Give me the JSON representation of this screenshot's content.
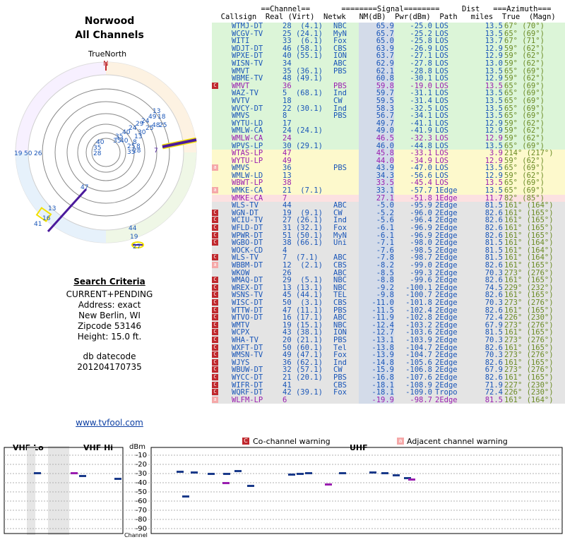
{
  "title_line1": "Norwood",
  "title_line2": "All Channels",
  "compass_label": "TrueNorth",
  "compass_n": "N",
  "criteria": {
    "heading": "Search Criteria",
    "lines": [
      "CURRENT+PENDING",
      "Address: exact",
      "New Berlin, WI",
      "Zipcode 53146",
      "Height: 15.0 ft."
    ],
    "db_label": "db datecode",
    "db_value": "201204170735"
  },
  "link": "www.tvfool.com",
  "headers": {
    "line1": "           ==Channel==       ========Signal========     Dist   ===Azimuth===",
    "line2": "  Callsign  Real (Virt)  Netwk   NM(dB)  Pwr(dBm)  Path   miles  True  (Magn)"
  },
  "rows": [
    {
      "cs": "WTMJ-DT",
      "real": "28  (4.1)",
      "net": "NBC",
      "nm": "65.9",
      "pwr": "-25.0",
      "path": "LOS",
      "dist": "13.5",
      "az": "67° (70°)",
      "bg": "green",
      "color": "#1a56b8",
      "b": ""
    },
    {
      "cs": "WCGV-TV",
      "real": "25 (24.1)",
      "net": "MyN",
      "nm": "65.7",
      "pwr": "-25.2",
      "path": "LOS",
      "dist": "13.5",
      "az": "65° (69°)",
      "bg": "green",
      "color": "#1a56b8",
      "b": ""
    },
    {
      "cs": "WITI",
      "real": "33  (6.1)",
      "net": "Fox",
      "nm": "65.0",
      "pwr": "-25.8",
      "path": "LOS",
      "dist": "13.7",
      "az": "67° (71°)",
      "bg": "green",
      "color": "#1a56b8",
      "b": ""
    },
    {
      "cs": "WDJT-DT",
      "real": "46 (58.1)",
      "net": "CBS",
      "nm": "63.9",
      "pwr": "-26.9",
      "path": "LOS",
      "dist": "12.9",
      "az": "59° (62°)",
      "bg": "green",
      "color": "#1a56b8",
      "b": ""
    },
    {
      "cs": "WPXE-DT",
      "real": "40 (55.1)",
      "net": "ION",
      "nm": "63.7",
      "pwr": "-27.1",
      "path": "LOS",
      "dist": "12.9",
      "az": "59° (62°)",
      "bg": "green",
      "color": "#1a56b8",
      "b": ""
    },
    {
      "cs": "WISN-TV",
      "real": "34",
      "net": "ABC",
      "nm": "62.9",
      "pwr": "-27.8",
      "path": "LOS",
      "dist": "13.0",
      "az": "59° (62°)",
      "bg": "green",
      "color": "#1a56b8",
      "b": ""
    },
    {
      "cs": "WMVT",
      "real": "35 (36.1)",
      "net": "PBS",
      "nm": "62.1",
      "pwr": "-28.8",
      "path": "LOS",
      "dist": "13.5",
      "az": "65° (69°)",
      "bg": "green",
      "color": "#1a56b8",
      "b": ""
    },
    {
      "cs": "WBME-TV",
      "real": "48 (49.1)",
      "net": "",
      "nm": "60.8",
      "pwr": "-30.1",
      "path": "LOS",
      "dist": "12.9",
      "az": "59° (62°)",
      "bg": "green",
      "color": "#1a56b8",
      "b": ""
    },
    {
      "cs": "WMVT",
      "real": "36",
      "net": "PBS",
      "nm": "59.8",
      "pwr": "-19.0",
      "path": "LOS",
      "dist": "13.5",
      "az": "65° (69°)",
      "bg": "green",
      "color": "#9a1eb0",
      "b": "C"
    },
    {
      "cs": "WAZ-TV",
      "real": "5  (68.1)",
      "net": "Ind",
      "nm": "59.7",
      "pwr": "-31.1",
      "path": "LOS",
      "dist": "13.5",
      "az": "65° (69°)",
      "bg": "green",
      "color": "#1a56b8",
      "b": ""
    },
    {
      "cs": "WVTV",
      "real": "18",
      "net": "CW",
      "nm": "59.5",
      "pwr": "-31.4",
      "path": "LOS",
      "dist": "13.5",
      "az": "65° (69°)",
      "bg": "green",
      "color": "#1a56b8",
      "b": ""
    },
    {
      "cs": "WVCY-DT",
      "real": "22 (30.1)",
      "net": "Ind",
      "nm": "58.3",
      "pwr": "-32.5",
      "path": "LOS",
      "dist": "13.5",
      "az": "65° (69°)",
      "bg": "green",
      "color": "#1a56b8",
      "b": ""
    },
    {
      "cs": "WMVS",
      "real": "8",
      "net": "PBS",
      "nm": "56.7",
      "pwr": "-34.1",
      "path": "LOS",
      "dist": "13.5",
      "az": "65° (69°)",
      "bg": "green",
      "color": "#1a56b8",
      "b": ""
    },
    {
      "cs": "WYTU-LD",
      "real": "17",
      "net": "",
      "nm": "49.7",
      "pwr": "-41.1",
      "path": "LOS",
      "dist": "12.9",
      "az": "59° (62°)",
      "bg": "green",
      "color": "#1a56b8",
      "b": ""
    },
    {
      "cs": "WMLW-CA",
      "real": "24 (24.1)",
      "net": "",
      "nm": "49.0",
      "pwr": "-41.9",
      "path": "LOS",
      "dist": "12.9",
      "az": "59° (62°)",
      "bg": "green",
      "color": "#1a56b8",
      "b": ""
    },
    {
      "cs": "WMLW-CA",
      "real": "24",
      "net": "",
      "nm": "46.5",
      "pwr": "-32.3",
      "path": "LOS",
      "dist": "12.9",
      "az": "59° (62°)",
      "bg": "green",
      "color": "#9a1eb0",
      "b": ""
    },
    {
      "cs": "WPVS-LP",
      "real": "30 (29.1)",
      "net": "",
      "nm": "46.0",
      "pwr": "-44.8",
      "path": "LOS",
      "dist": "13.5",
      "az": "65° (69°)",
      "bg": "green",
      "color": "#1a56b8",
      "b": ""
    },
    {
      "cs": "WTAS-LP",
      "real": "47",
      "net": "",
      "nm": "45.8",
      "pwr": "-33.1",
      "path": "LOS",
      "dist": "3.9",
      "az": "214° (217°)",
      "bg": "yellow",
      "color": "#9a1eb0",
      "b": ""
    },
    {
      "cs": "WYTU-LP",
      "real": "49",
      "net": "",
      "nm": "44.0",
      "pwr": "-34.9",
      "path": "LOS",
      "dist": "12.9",
      "az": "59° (62°)",
      "bg": "yellow",
      "color": "#9a1eb0",
      "b": ""
    },
    {
      "cs": "WMVS",
      "real": "36",
      "net": "PBS",
      "nm": "43.9",
      "pwr": "-47.0",
      "path": "LOS",
      "dist": "13.5",
      "az": "65° (69°)",
      "bg": "yellow",
      "color": "#1a56b8",
      "b": "a"
    },
    {
      "cs": "WMLW-LD",
      "real": "13",
      "net": "",
      "nm": "34.3",
      "pwr": "-56.6",
      "path": "LOS",
      "dist": "12.9",
      "az": "59° (62°)",
      "bg": "yellow",
      "color": "#1a56b8",
      "b": ""
    },
    {
      "cs": "WBWT-LP",
      "real": "38",
      "net": "",
      "nm": "33.5",
      "pwr": "-45.4",
      "path": "LOS",
      "dist": "13.5",
      "az": "65° (69°)",
      "bg": "yellow",
      "color": "#9a1eb0",
      "b": ""
    },
    {
      "cs": "WMKE-CA",
      "real": "21  (7.1)",
      "net": "",
      "nm": "33.1",
      "pwr": "-57.7",
      "path": "1Edge",
      "dist": "13.5",
      "az": "65° (69°)",
      "bg": "yellow",
      "color": "#1a56b8",
      "b": "a"
    },
    {
      "cs": "WMKE-CA",
      "real": "7",
      "net": "",
      "nm": "27.1",
      "pwr": "-51.8",
      "path": "1Edge",
      "dist": "11.7",
      "az": "82° (85°)",
      "bg": "pink",
      "color": "#9a1eb0",
      "b": ""
    },
    {
      "cs": "WLS-TV",
      "real": "44",
      "net": "ABC",
      "nm": "-5.0",
      "pwr": "-95.9",
      "path": "2Edge",
      "dist": "81.5",
      "az": "161° (164°)",
      "bg": "gray",
      "color": "#1a56b8",
      "b": ""
    },
    {
      "cs": "WGN-DT",
      "real": "19  (9.1)",
      "net": "CW",
      "nm": "-5.2",
      "pwr": "-96.0",
      "path": "2Edge",
      "dist": "82.6",
      "az": "161° (165°)",
      "bg": "gray",
      "color": "#1a56b8",
      "b": "C"
    },
    {
      "cs": "WCIU-TV",
      "real": "27 (26.1)",
      "net": "Ind",
      "nm": "-5.6",
      "pwr": "-96.4",
      "path": "2Edge",
      "dist": "82.6",
      "az": "161° (165°)",
      "bg": "gray",
      "color": "#1a56b8",
      "b": "C"
    },
    {
      "cs": "WFLD-DT",
      "real": "31 (32.1)",
      "net": "Fox",
      "nm": "-6.1",
      "pwr": "-96.9",
      "path": "2Edge",
      "dist": "82.6",
      "az": "161° (165°)",
      "bg": "gray",
      "color": "#1a56b8",
      "b": "C"
    },
    {
      "cs": "WPWR-DT",
      "real": "51 (50.1)",
      "net": "MyN",
      "nm": "-6.1",
      "pwr": "-96.9",
      "path": "2Edge",
      "dist": "82.6",
      "az": "161° (165°)",
      "bg": "gray",
      "color": "#1a56b8",
      "b": "C"
    },
    {
      "cs": "WGBO-DT",
      "real": "38 (66.1)",
      "net": "Uni",
      "nm": "-7.1",
      "pwr": "-98.0",
      "path": "2Edge",
      "dist": "81.5",
      "az": "161° (164°)",
      "bg": "gray",
      "color": "#1a56b8",
      "b": "C"
    },
    {
      "cs": "WOCK-CD",
      "real": "4",
      "net": "",
      "nm": "-7.6",
      "pwr": "-98.5",
      "path": "2Edge",
      "dist": "81.5",
      "az": "161° (164°)",
      "bg": "gray",
      "color": "#1a56b8",
      "b": ""
    },
    {
      "cs": "WLS-TV",
      "real": "7  (7.1)",
      "net": "ABC",
      "nm": "-7.8",
      "pwr": "-98.7",
      "path": "2Edge",
      "dist": "81.5",
      "az": "161° (164°)",
      "bg": "gray",
      "color": "#1a56b8",
      "b": "C"
    },
    {
      "cs": "WBBM-DT",
      "real": "12  (2.1)",
      "net": "CBS",
      "nm": "-8.2",
      "pwr": "-99.0",
      "path": "2Edge",
      "dist": "82.6",
      "az": "161° (165°)",
      "bg": "gray",
      "color": "#1a56b8",
      "b": "a"
    },
    {
      "cs": "WKOW",
      "real": "26",
      "net": "ABC",
      "nm": "-8.5",
      "pwr": "-99.3",
      "path": "2Edge",
      "dist": "70.3",
      "az": "273° (276°)",
      "bg": "gray",
      "color": "#1a56b8",
      "b": ""
    },
    {
      "cs": "WMAQ-DT",
      "real": "29  (5.1)",
      "net": "NBC",
      "nm": "-8.8",
      "pwr": "-99.6",
      "path": "2Edge",
      "dist": "82.6",
      "az": "161° (165°)",
      "bg": "gray",
      "color": "#1a56b8",
      "b": "C"
    },
    {
      "cs": "WREX-DT",
      "real": "13 (13.1)",
      "net": "NBC",
      "nm": "-9.2",
      "pwr": "-100.1",
      "path": "2Edge",
      "dist": "74.5",
      "az": "229° (232°)",
      "bg": "gray",
      "color": "#1a56b8",
      "b": "C"
    },
    {
      "cs": "WSNS-TV",
      "real": "45 (44.1)",
      "net": "TEL",
      "nm": "-9.8",
      "pwr": "-100.7",
      "path": "2Edge",
      "dist": "82.6",
      "az": "161° (165°)",
      "bg": "gray",
      "color": "#1a56b8",
      "b": "C"
    },
    {
      "cs": "WISC-DT",
      "real": "50  (3.1)",
      "net": "CBS",
      "nm": "-11.0",
      "pwr": "-101.8",
      "path": "2Edge",
      "dist": "70.3",
      "az": "273° (276°)",
      "bg": "gray",
      "color": "#1a56b8",
      "b": "C"
    },
    {
      "cs": "WTTW-DT",
      "real": "47 (11.1)",
      "net": "PBS",
      "nm": "-11.5",
      "pwr": "-102.4",
      "path": "2Edge",
      "dist": "82.6",
      "az": "161° (165°)",
      "bg": "gray",
      "color": "#1a56b8",
      "b": "C"
    },
    {
      "cs": "WTVO-DT",
      "real": "16 (17.1)",
      "net": "ABC",
      "nm": "-11.9",
      "pwr": "-102.8",
      "path": "2Edge",
      "dist": "72.4",
      "az": "226° (230°)",
      "bg": "gray",
      "color": "#1a56b8",
      "b": "C"
    },
    {
      "cs": "WMTV",
      "real": "19 (15.1)",
      "net": "NBC",
      "nm": "-12.4",
      "pwr": "-103.2",
      "path": "2Edge",
      "dist": "67.9",
      "az": "273° (276°)",
      "bg": "gray",
      "color": "#1a56b8",
      "b": "C"
    },
    {
      "cs": "WCPX",
      "real": "43 (38.1)",
      "net": "ION",
      "nm": "-12.7",
      "pwr": "-103.6",
      "path": "2Edge",
      "dist": "81.5",
      "az": "161° (165°)",
      "bg": "gray",
      "color": "#1a56b8",
      "b": "C"
    },
    {
      "cs": "WHA-TV",
      "real": "20 (21.1)",
      "net": "PBS",
      "nm": "-13.1",
      "pwr": "-103.9",
      "path": "2Edge",
      "dist": "70.3",
      "az": "273° (276°)",
      "bg": "gray",
      "color": "#1a56b8",
      "b": "C"
    },
    {
      "cs": "WXFT-DT",
      "real": "50 (60.1)",
      "net": "Tel",
      "nm": "-13.8",
      "pwr": "-104.7",
      "path": "2Edge",
      "dist": "82.6",
      "az": "161° (165°)",
      "bg": "gray",
      "color": "#1a56b8",
      "b": "C"
    },
    {
      "cs": "WMSN-TV",
      "real": "49 (47.1)",
      "net": "Fox",
      "nm": "-13.9",
      "pwr": "-104.7",
      "path": "2Edge",
      "dist": "70.3",
      "az": "273° (276°)",
      "bg": "gray",
      "color": "#1a56b8",
      "b": "C"
    },
    {
      "cs": "WJYS",
      "real": "36 (62.1)",
      "net": "Ind",
      "nm": "-14.8",
      "pwr": "-105.6",
      "path": "2Edge",
      "dist": "82.6",
      "az": "161° (165°)",
      "bg": "gray",
      "color": "#1a56b8",
      "b": "C"
    },
    {
      "cs": "WBUW-DT",
      "real": "32 (57.1)",
      "net": "CW",
      "nm": "-15.9",
      "pwr": "-106.8",
      "path": "2Edge",
      "dist": "67.9",
      "az": "273° (276°)",
      "bg": "gray",
      "color": "#1a56b8",
      "b": "C"
    },
    {
      "cs": "WYCC-DT",
      "real": "21 (20.1)",
      "net": "PBS",
      "nm": "-16.8",
      "pwr": "-107.6",
      "path": "2Edge",
      "dist": "82.6",
      "az": "161° (165°)",
      "bg": "gray",
      "color": "#1a56b8",
      "b": "C"
    },
    {
      "cs": "WIFR-DT",
      "real": "41",
      "net": "CBS",
      "nm": "-18.1",
      "pwr": "-108.9",
      "path": "2Edge",
      "dist": "71.9",
      "az": "227° (230°)",
      "bg": "gray",
      "color": "#1a56b8",
      "b": "C"
    },
    {
      "cs": "WQRF-DT",
      "real": "42 (39.1)",
      "net": "Fox",
      "nm": "-18.1",
      "pwr": "-109.0",
      "path": "Tropo",
      "dist": "72.4",
      "az": "226° (230°)",
      "bg": "gray",
      "color": "#1a56b8",
      "b": "C"
    },
    {
      "cs": "WLFM-LP",
      "real": "6",
      "net": "",
      "nm": "-19.9",
      "pwr": "-98.7",
      "path": "2Edge",
      "dist": "81.5",
      "az": "161° (164°)",
      "bg": "gray",
      "color": "#9a1eb0",
      "b": "a"
    }
  ],
  "legend": {
    "co": "Co-channel warning",
    "adj": "Adjacent channel warning"
  },
  "bottom": {
    "vhf_lo": "VHF Lo",
    "vhf_hi": "VHF Hi",
    "uhf": "UHF",
    "dbm": "dBm",
    "channel": "Channel",
    "yticks": [
      "-10",
      "-20",
      "-30",
      "-40",
      "-50",
      "-60",
      "-70",
      "-80",
      "-90"
    ]
  },
  "colors": {
    "accent": "#1a56b8",
    "purple": "#9a1eb0",
    "warn": "#c0282d"
  }
}
